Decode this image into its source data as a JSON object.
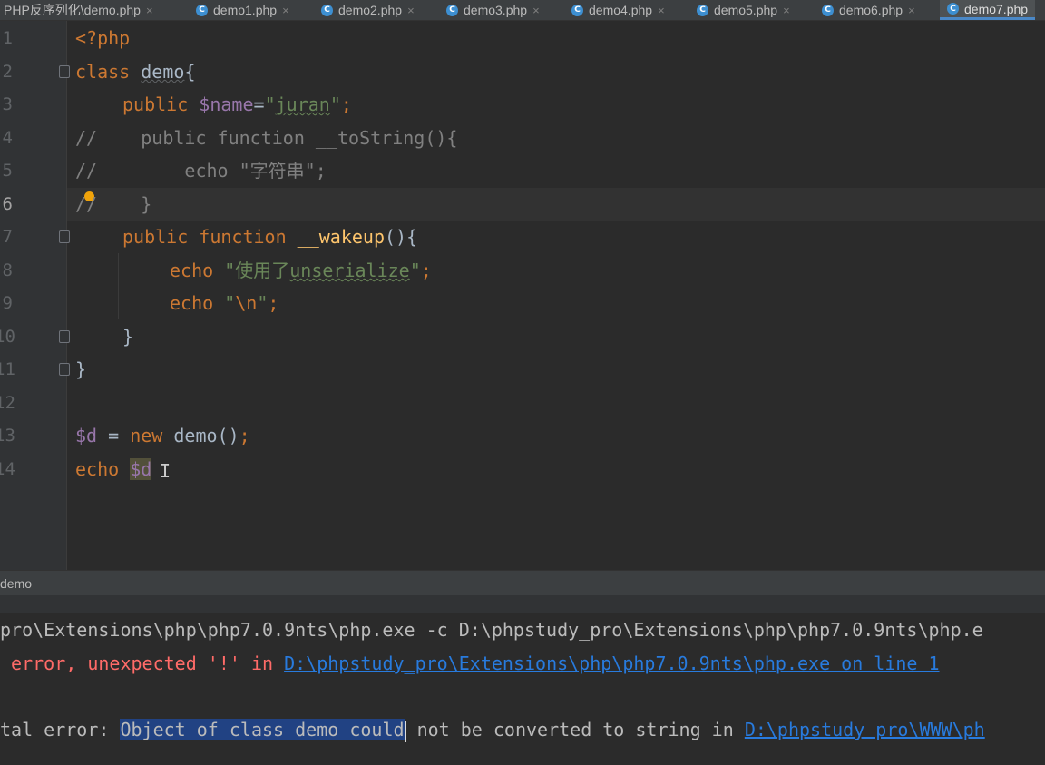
{
  "tabs": [
    {
      "label": "PHP反序列化\\demo.php",
      "close": "×"
    },
    {
      "label": "demo1.php",
      "close": "×"
    },
    {
      "label": "demo2.php",
      "close": "×"
    },
    {
      "label": "demo3.php",
      "close": "×"
    },
    {
      "label": "demo4.php",
      "close": "×"
    },
    {
      "label": "demo5.php",
      "close": "×"
    },
    {
      "label": "demo6.php",
      "close": "×"
    },
    {
      "label": "demo7.php",
      "close": ""
    }
  ],
  "active_tab": "demo7.php",
  "tab_icon_letter": "C",
  "editor": {
    "line_numbers": [
      "1",
      "2",
      "3",
      "4",
      "5",
      "6",
      "7",
      "8",
      "9",
      "10",
      "11",
      "12",
      "13",
      "14"
    ],
    "current_line": "6",
    "code": {
      "l1": "<?php",
      "l2_kw": "class",
      "l2_name": "demo",
      "l2_brace": "{",
      "l3_kw": "public",
      "l3_var": "$name",
      "l3_eq": "=",
      "l3_q1": "\"",
      "l3_str": "juran",
      "l3_q2": "\"",
      "l3_semi": ";",
      "l4": "//    public function __toString(){",
      "l5_a": "/",
      "l5_b": "/        echo \"字符串\";",
      "l6": "//    }",
      "l7_kw1": "public",
      "l7_kw2": "function",
      "l7_fn": "__wakeup",
      "l7_rest": "(){",
      "l8_kw": "echo",
      "l8_q1": "\"使用了",
      "l8_str": "unserialize",
      "l8_q2": "\"",
      "l8_semi": ";",
      "l9_kw": "echo",
      "l9_q1": "\"",
      "l9_esc": "\\n",
      "l9_q2": "\"",
      "l9_semi": ";",
      "l10": "}",
      "l11": "}",
      "l13_var": "$d",
      "l13_eq": " = ",
      "l13_kw": "new",
      "l13_rest": " demo()",
      "l13_semi": ";",
      "l14_kw": "echo",
      "l14_var": "$d"
    }
  },
  "run_panel": {
    "title": "demo",
    "lines": {
      "line1": "pro\\Extensions\\php\\php7.0.9nts\\php.exe -c D:\\phpstudy_pro\\Extensions\\php\\php7.0.9nts\\php.e",
      "line2_text": " error, unexpected '!' in ",
      "line2_link": "D:\\phpstudy_pro\\Extensions\\php\\php7.0.9nts\\php.exe on line 1",
      "line4_pre": "tal error: ",
      "line4_sel": "Object of class demo could",
      "line4_post": " not be converted to string in ",
      "line4_link": "D:\\phpstudy_pro\\WWW\\ph"
    }
  },
  "colors": {
    "keyword": "#cc7832",
    "variable": "#9876aa",
    "string": "#6a8759",
    "function": "#ffc66d",
    "comment": "#808080",
    "error": "#ff6b68",
    "link": "#287bde",
    "selection": "#214283"
  }
}
